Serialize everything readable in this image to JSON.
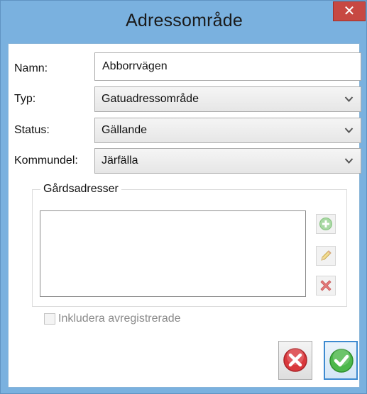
{
  "window": {
    "title": "Adressområde",
    "close_glyph": "✕"
  },
  "form": {
    "namn_label": "Namn:",
    "namn_value": "Abborrvägen",
    "typ_label": "Typ:",
    "typ_value": "Gatuadressområde",
    "status_label": "Status:",
    "status_value": "Gällande",
    "kommundel_label": "Kommundel:",
    "kommundel_value": "Järfälla"
  },
  "group": {
    "title": "Gårdsadresser",
    "items": [],
    "add_icon": "add-icon",
    "edit_icon": "pencil-icon",
    "delete_icon": "delete-x-icon"
  },
  "checkbox": {
    "label": "Inkludera avregistrerade",
    "checked": false,
    "enabled": false
  },
  "buttons": {
    "cancel_icon": "cancel-icon",
    "ok_icon": "ok-check-icon"
  },
  "colors": {
    "titlebar": "#7ab1df",
    "close": "#c74842",
    "cancel_red": "#d9383c",
    "ok_green": "#4cb84a"
  }
}
